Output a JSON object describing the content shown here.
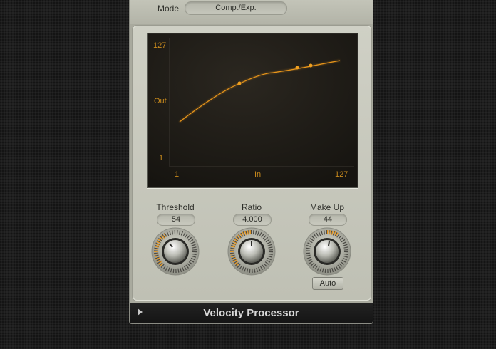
{
  "mode": {
    "label": "Mode",
    "value": "Comp./Exp."
  },
  "graph": {
    "y_max_label": "127",
    "y_title": "Out",
    "y_min_label": "1",
    "x_min_label": "1",
    "x_title": "In",
    "x_max_label": "127",
    "curve_color": "#e8951a"
  },
  "controls": {
    "threshold": {
      "label": "Threshold",
      "value": "54"
    },
    "ratio": {
      "label": "Ratio",
      "value": "4.000"
    },
    "makeup": {
      "label": "Make Up",
      "value": "44",
      "auto_label": "Auto"
    }
  },
  "footer": {
    "title": "Velocity Processor",
    "toggle_icon": "disclosure-triangle-icon"
  },
  "colors": {
    "panel": "#c8c9be",
    "accent": "#e8951a",
    "footer_bg": "#1a1a1a"
  }
}
